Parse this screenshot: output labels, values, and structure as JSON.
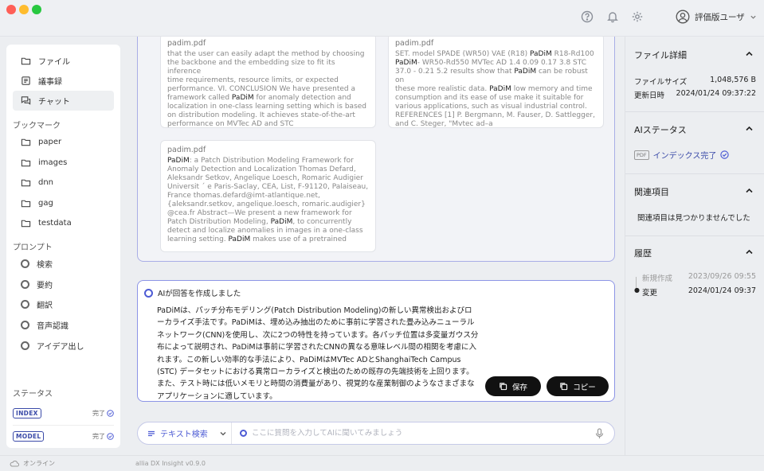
{
  "header": {
    "user_name": "評価版ユーザ"
  },
  "sidebar": {
    "nav": [
      {
        "label": "ファイル",
        "icon": "folder-icon"
      },
      {
        "label": "議事録",
        "icon": "document-icon"
      },
      {
        "label": "チャット",
        "icon": "chat-icon",
        "active": true
      }
    ],
    "bookmarks_title": "ブックマーク",
    "bookmarks": [
      "paper",
      "images",
      "dnn",
      "gag",
      "testdata"
    ],
    "prompts_title": "プロンプト",
    "prompts": [
      "検索",
      "要約",
      "翻訳",
      "音声認識",
      "アイデア出し"
    ],
    "status_title": "ステータス",
    "status": [
      {
        "badge": "INDEX",
        "value": "完了"
      },
      {
        "badge": "MODEL",
        "value": "完了"
      }
    ]
  },
  "results": {
    "cards": [
      {
        "filename": "padim.pdf",
        "segments": [
          {
            "t": " that the user can easily adapt the method by choosing\nthe backbone and the embedding size to fit its inference\ntime requirements, resource limits, or expected\nperformance. VI. CONCLUSION We have presented a\nframework called "
          },
          {
            "t": "PaDiM",
            "hl": true
          },
          {
            "t": " for anomaly detection and\nlocalization in one-class learning setting which is based\non distribution modeling. It achieves state-of-the-art\nperformance on MVTec AD and STC"
          }
        ]
      },
      {
        "filename": "padim.pdf",
        "segments": [
          {
            "t": "SET. model SPADE (WR50) VAE (R18) "
          },
          {
            "t": "PaDiM",
            "hl": true
          },
          {
            "t": " R18-Rd100\n"
          },
          {
            "t": "PaDiM",
            "hl": true
          },
          {
            "t": "- WR50-Rd550 MVTec AD 1.4 0.09 0.17 3.8 STC\n37.0 - 0.21 5.2 results show that "
          },
          {
            "t": "PaDiM",
            "hl": true
          },
          {
            "t": " can be robust on\nthese more realistic data. "
          },
          {
            "t": "PaDiM",
            "hl": true
          },
          {
            "t": " low memory and time\nconsumption and its ease of use make it suitable for\nvarious applications, such as visual industrial control.\nREFERENCES [1] P. Bergmann, M. Fauser, D. Sattlegger,\nand C. Steger, \"Mvtec ad–a"
          }
        ]
      },
      {
        "filename": "padim.pdf",
        "segments": [
          {
            "t": "PaDiM",
            "hl": true
          },
          {
            "t": ": a Patch Distribution Modeling Framework for\nAnomaly Detection and Localization Thomas Defard,\nAleksandr Setkov, Angelique Loesch, Romaric Audigier\nUniversit ´ e Paris-Saclay, CEA, List, F-91120, Palaiseau,\nFrance thomas.defard@imt-atlantique.net,\n{aleksandr.setkov, angelique.loesch, romaric.audigier}\n@cea.fr Abstract—We present a new framework for\nPatch Distribution Modeling, "
          },
          {
            "t": "PaDiM",
            "hl": true
          },
          {
            "t": ", to concurrently\ndetect and localize anomalies in images in a one-class\nlearning setting. "
          },
          {
            "t": "PaDiM",
            "hl": true
          },
          {
            "t": " makes use of a pretrained"
          }
        ]
      }
    ]
  },
  "answer": {
    "header": "AIが回答を作成しました",
    "text": "PaDiMは、パッチ分布モデリング(Patch Distribution Modeling)の新しい異常検出およびローカライズ手法です。PaDiMは、埋め込み抽出のために事前に学習された畳み込みニューラルネットワーク(CNN)を使用し、次に2つの特性を持っています。各パッチ位置は多変量ガウス分布によって説明され、PaDiMは事前に学習されたCNNの異なる意味レベル間の相関を考慮に入れます。この新しい効率的な手法により、PaDiMはMVTec ADとShanghaiTech Campus (STC) データセットにおける異常ローカライズと検出のための既存の先端技術を上回ります。また、テスト時には低いメモリと時間の消費量があり、視覚的な産業制御のようなさまざまなアプリケーションに適しています。",
    "save_label": "保存",
    "copy_label": "コピー"
  },
  "input": {
    "mode_label": "テキスト検索",
    "placeholder": "ここに質問を入力してAIに聞いてみましょう"
  },
  "right_panel": {
    "file_details": {
      "title": "ファイル詳細",
      "rows": [
        {
          "label": "ファイルサイズ",
          "value": "1,048,576 B"
        },
        {
          "label": "更新日時",
          "value": "2024/01/24 09:37:22"
        }
      ]
    },
    "ai_status": {
      "title": "AIステータス",
      "badge": "PDF",
      "value": "インデックス完了"
    },
    "related": {
      "title": "関連項目",
      "empty": "関連項目は見つかりませんでした"
    },
    "history": {
      "title": "履歴",
      "items": [
        {
          "label": "新規作成",
          "date": "2023/09/26 09:55"
        },
        {
          "label": "変更",
          "date": "2024/01/24 09:37"
        }
      ]
    }
  },
  "statusbar": {
    "online": "オンライン",
    "version": "allia DX Insight v0.9.0"
  },
  "colors": {
    "accent": "#4d5bd4",
    "badge": "#3a4aa8"
  }
}
